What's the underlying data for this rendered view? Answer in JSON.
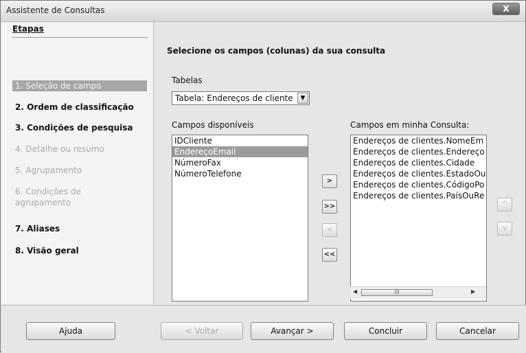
{
  "window": {
    "title": "Assistente de Consultas",
    "close_label": "X"
  },
  "steps": {
    "heading": "Etapas",
    "items": [
      {
        "label": "1. Seleção de campo"
      },
      {
        "label": "2. Ordem de classificação"
      },
      {
        "label": "3. Condições de pesquisa"
      },
      {
        "label": "4. Detalhe ou resumo"
      },
      {
        "label": "5. Agrupamento"
      },
      {
        "label": "6. Condições de agrupamento"
      },
      {
        "label": "7. Aliases"
      },
      {
        "label": "8. Visão geral"
      }
    ]
  },
  "main": {
    "heading": "Selecione os campos (colunas) da sua consulta",
    "tables_label": "Tabelas",
    "tables_value": "Tabela: Endereços de cliente",
    "available_label": "Campos disponíveis",
    "available_fields": [
      "IDCliente",
      "EndereçoEmail",
      "NúmeroFax",
      "NúmeroTelefone"
    ],
    "query_label": "Campos em minha Consulta:",
    "query_fields": [
      "Endereços de clientes.NomeEm",
      "Endereços de clientes.Endereço",
      "Endereços de clientes.Cidade",
      "Endereços de clientes.EstadoOu",
      "Endereços de clientes.CódigoPo",
      "Endereços de clientes.PaísOuRe"
    ],
    "move_buttons": {
      "add_one": ">",
      "add_all": ">>",
      "remove_one": "<",
      "remove_all": "<<"
    },
    "order_buttons": {
      "up": "^",
      "down": "v"
    },
    "scroll_thumb_label": "III"
  },
  "buttons": {
    "help": "Ajuda",
    "back": "< Voltar",
    "next": "Avançar >",
    "finish": "Concluir",
    "cancel": "Cancelar"
  }
}
